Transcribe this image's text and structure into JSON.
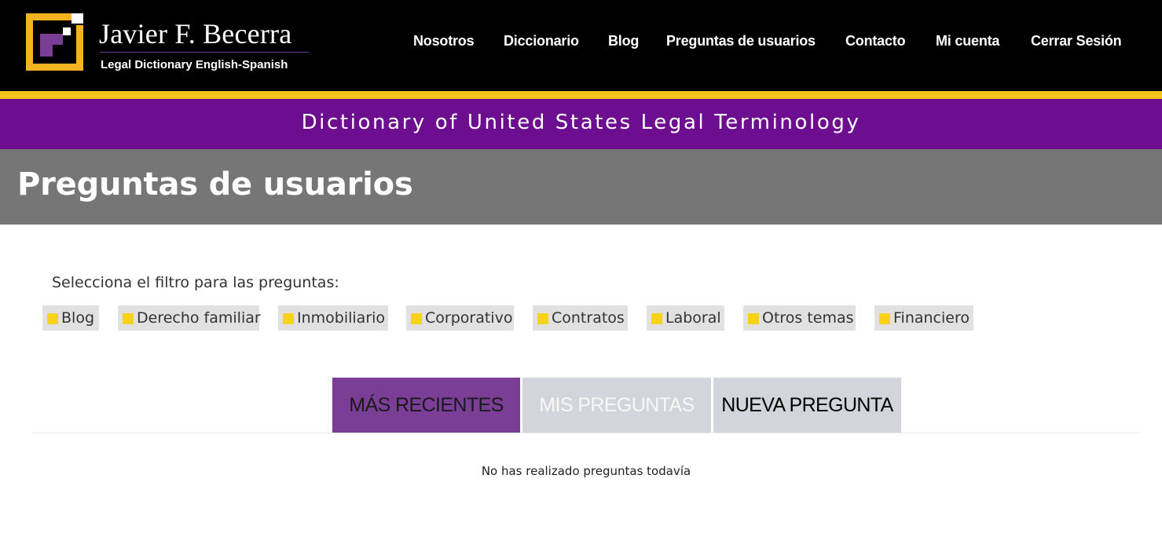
{
  "header": {
    "brand_name": "Javier F. Becerra",
    "brand_tagline": "Legal Dictionary English-Spanish",
    "nav": [
      {
        "label": "Nosotros"
      },
      {
        "label": "Diccionario"
      },
      {
        "label": "Blog"
      },
      {
        "label": "Preguntas de usuarios"
      },
      {
        "label": "Contacto"
      },
      {
        "label": "Mi cuenta"
      },
      {
        "label": "Cerrar Sesión"
      }
    ]
  },
  "banner": {
    "title": "Dictionary of United States Legal Terminology"
  },
  "page": {
    "title": "Preguntas de usuarios"
  },
  "filters": {
    "label": "Selecciona el filtro para las preguntas:",
    "items": [
      {
        "label": "Blog"
      },
      {
        "label": "Derecho familiar"
      },
      {
        "label": "Inmobiliario"
      },
      {
        "label": "Corporativo"
      },
      {
        "label": "Contratos"
      },
      {
        "label": "Laboral"
      },
      {
        "label": "Otros temas"
      },
      {
        "label": "Financiero"
      }
    ]
  },
  "tabs": [
    {
      "label": "MÁS RECIENTES",
      "active": true
    },
    {
      "label": "MIS PREGUNTAS",
      "active": false
    },
    {
      "label": "NUEVA PREGUNTA",
      "active": false
    }
  ],
  "empty_message": "No has realizado preguntas todavía",
  "colors": {
    "header_bg": "#000000",
    "gold_accent": "#f3c31c",
    "purple_band": "#6d0d90",
    "gray_band": "#767676",
    "active_tab": "#7a3e97",
    "inactive_tab": "#d4d5dc",
    "chip_bg": "#e1e1e1",
    "chip_swatch": "#f6d21a"
  },
  "icons": {
    "logo": "brand-logo-icon",
    "filter_marker": "square-swatch-icon"
  }
}
